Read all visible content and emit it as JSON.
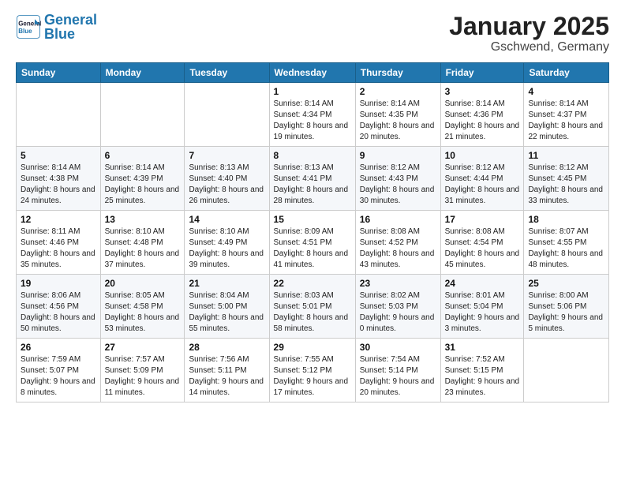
{
  "header": {
    "logo_general": "General",
    "logo_blue": "Blue",
    "month": "January 2025",
    "location": "Gschwend, Germany"
  },
  "weekdays": [
    "Sunday",
    "Monday",
    "Tuesday",
    "Wednesday",
    "Thursday",
    "Friday",
    "Saturday"
  ],
  "weeks": [
    [
      {
        "day": "",
        "sunrise": "",
        "sunset": "",
        "daylight": ""
      },
      {
        "day": "",
        "sunrise": "",
        "sunset": "",
        "daylight": ""
      },
      {
        "day": "",
        "sunrise": "",
        "sunset": "",
        "daylight": ""
      },
      {
        "day": "1",
        "sunrise": "Sunrise: 8:14 AM",
        "sunset": "Sunset: 4:34 PM",
        "daylight": "Daylight: 8 hours and 19 minutes."
      },
      {
        "day": "2",
        "sunrise": "Sunrise: 8:14 AM",
        "sunset": "Sunset: 4:35 PM",
        "daylight": "Daylight: 8 hours and 20 minutes."
      },
      {
        "day": "3",
        "sunrise": "Sunrise: 8:14 AM",
        "sunset": "Sunset: 4:36 PM",
        "daylight": "Daylight: 8 hours and 21 minutes."
      },
      {
        "day": "4",
        "sunrise": "Sunrise: 8:14 AM",
        "sunset": "Sunset: 4:37 PM",
        "daylight": "Daylight: 8 hours and 22 minutes."
      }
    ],
    [
      {
        "day": "5",
        "sunrise": "Sunrise: 8:14 AM",
        "sunset": "Sunset: 4:38 PM",
        "daylight": "Daylight: 8 hours and 24 minutes."
      },
      {
        "day": "6",
        "sunrise": "Sunrise: 8:14 AM",
        "sunset": "Sunset: 4:39 PM",
        "daylight": "Daylight: 8 hours and 25 minutes."
      },
      {
        "day": "7",
        "sunrise": "Sunrise: 8:13 AM",
        "sunset": "Sunset: 4:40 PM",
        "daylight": "Daylight: 8 hours and 26 minutes."
      },
      {
        "day": "8",
        "sunrise": "Sunrise: 8:13 AM",
        "sunset": "Sunset: 4:41 PM",
        "daylight": "Daylight: 8 hours and 28 minutes."
      },
      {
        "day": "9",
        "sunrise": "Sunrise: 8:12 AM",
        "sunset": "Sunset: 4:43 PM",
        "daylight": "Daylight: 8 hours and 30 minutes."
      },
      {
        "day": "10",
        "sunrise": "Sunrise: 8:12 AM",
        "sunset": "Sunset: 4:44 PM",
        "daylight": "Daylight: 8 hours and 31 minutes."
      },
      {
        "day": "11",
        "sunrise": "Sunrise: 8:12 AM",
        "sunset": "Sunset: 4:45 PM",
        "daylight": "Daylight: 8 hours and 33 minutes."
      }
    ],
    [
      {
        "day": "12",
        "sunrise": "Sunrise: 8:11 AM",
        "sunset": "Sunset: 4:46 PM",
        "daylight": "Daylight: 8 hours and 35 minutes."
      },
      {
        "day": "13",
        "sunrise": "Sunrise: 8:10 AM",
        "sunset": "Sunset: 4:48 PM",
        "daylight": "Daylight: 8 hours and 37 minutes."
      },
      {
        "day": "14",
        "sunrise": "Sunrise: 8:10 AM",
        "sunset": "Sunset: 4:49 PM",
        "daylight": "Daylight: 8 hours and 39 minutes."
      },
      {
        "day": "15",
        "sunrise": "Sunrise: 8:09 AM",
        "sunset": "Sunset: 4:51 PM",
        "daylight": "Daylight: 8 hours and 41 minutes."
      },
      {
        "day": "16",
        "sunrise": "Sunrise: 8:08 AM",
        "sunset": "Sunset: 4:52 PM",
        "daylight": "Daylight: 8 hours and 43 minutes."
      },
      {
        "day": "17",
        "sunrise": "Sunrise: 8:08 AM",
        "sunset": "Sunset: 4:54 PM",
        "daylight": "Daylight: 8 hours and 45 minutes."
      },
      {
        "day": "18",
        "sunrise": "Sunrise: 8:07 AM",
        "sunset": "Sunset: 4:55 PM",
        "daylight": "Daylight: 8 hours and 48 minutes."
      }
    ],
    [
      {
        "day": "19",
        "sunrise": "Sunrise: 8:06 AM",
        "sunset": "Sunset: 4:56 PM",
        "daylight": "Daylight: 8 hours and 50 minutes."
      },
      {
        "day": "20",
        "sunrise": "Sunrise: 8:05 AM",
        "sunset": "Sunset: 4:58 PM",
        "daylight": "Daylight: 8 hours and 53 minutes."
      },
      {
        "day": "21",
        "sunrise": "Sunrise: 8:04 AM",
        "sunset": "Sunset: 5:00 PM",
        "daylight": "Daylight: 8 hours and 55 minutes."
      },
      {
        "day": "22",
        "sunrise": "Sunrise: 8:03 AM",
        "sunset": "Sunset: 5:01 PM",
        "daylight": "Daylight: 8 hours and 58 minutes."
      },
      {
        "day": "23",
        "sunrise": "Sunrise: 8:02 AM",
        "sunset": "Sunset: 5:03 PM",
        "daylight": "Daylight: 9 hours and 0 minutes."
      },
      {
        "day": "24",
        "sunrise": "Sunrise: 8:01 AM",
        "sunset": "Sunset: 5:04 PM",
        "daylight": "Daylight: 9 hours and 3 minutes."
      },
      {
        "day": "25",
        "sunrise": "Sunrise: 8:00 AM",
        "sunset": "Sunset: 5:06 PM",
        "daylight": "Daylight: 9 hours and 5 minutes."
      }
    ],
    [
      {
        "day": "26",
        "sunrise": "Sunrise: 7:59 AM",
        "sunset": "Sunset: 5:07 PM",
        "daylight": "Daylight: 9 hours and 8 minutes."
      },
      {
        "day": "27",
        "sunrise": "Sunrise: 7:57 AM",
        "sunset": "Sunset: 5:09 PM",
        "daylight": "Daylight: 9 hours and 11 minutes."
      },
      {
        "day": "28",
        "sunrise": "Sunrise: 7:56 AM",
        "sunset": "Sunset: 5:11 PM",
        "daylight": "Daylight: 9 hours and 14 minutes."
      },
      {
        "day": "29",
        "sunrise": "Sunrise: 7:55 AM",
        "sunset": "Sunset: 5:12 PM",
        "daylight": "Daylight: 9 hours and 17 minutes."
      },
      {
        "day": "30",
        "sunrise": "Sunrise: 7:54 AM",
        "sunset": "Sunset: 5:14 PM",
        "daylight": "Daylight: 9 hours and 20 minutes."
      },
      {
        "day": "31",
        "sunrise": "Sunrise: 7:52 AM",
        "sunset": "Sunset: 5:15 PM",
        "daylight": "Daylight: 9 hours and 23 minutes."
      },
      {
        "day": "",
        "sunrise": "",
        "sunset": "",
        "daylight": ""
      }
    ]
  ]
}
